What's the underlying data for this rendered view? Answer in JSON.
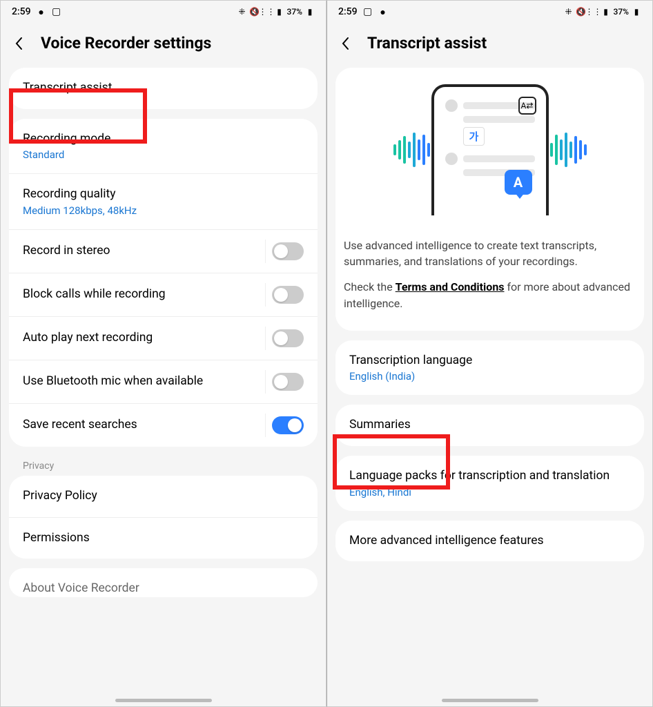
{
  "status": {
    "time": "2:59",
    "battery": "37%"
  },
  "left": {
    "title": "Voice Recorder settings",
    "item0": "Transcript assist",
    "rec_mode": "Recording mode",
    "rec_mode_v": "Standard",
    "rec_q": "Recording quality",
    "rec_q_v": "Medium 128kbps, 48kHz",
    "stereo": "Record in stereo",
    "block": "Block calls while recording",
    "autoplay": "Auto play next recording",
    "bt": "Use Bluetooth mic when available",
    "save": "Save recent searches",
    "privacy_h": "Privacy",
    "pp": "Privacy Policy",
    "perm": "Permissions",
    "about": "About Voice Recorder"
  },
  "right": {
    "title": "Transcript assist",
    "desc1": "Use advanced intelligence to create text transcripts, summaries, and translations of your recordings.",
    "desc2a": "Check the ",
    "desc2link": "Terms and Conditions",
    "desc2b": " for more about advanced intelligence.",
    "tl": "Transcription language",
    "tl_v": "English (India)",
    "sum": "Summaries",
    "lp": "Language packs for transcription and translation",
    "lp_v": "English, Hindi",
    "more": "More advanced intelligence features",
    "ga": "가",
    "a": "A"
  }
}
